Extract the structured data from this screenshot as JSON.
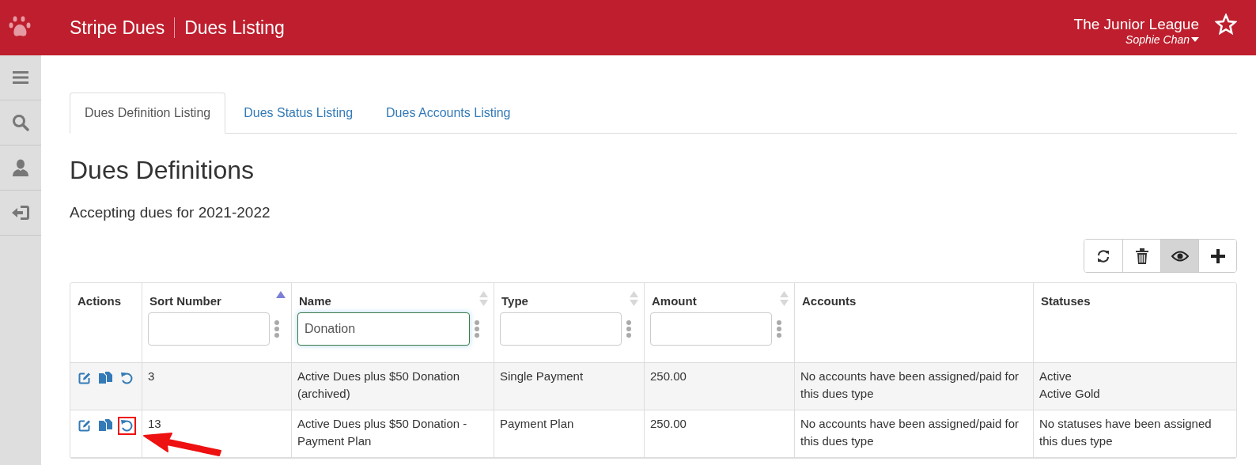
{
  "header": {
    "app_name": "Stripe Dues",
    "page_title": "Dues Listing",
    "organization": "The Junior League",
    "user": "Sophie Chan"
  },
  "sidebar": {
    "items": [
      {
        "kind": "menu"
      },
      {
        "kind": "search"
      },
      {
        "kind": "user"
      },
      {
        "kind": "logout"
      }
    ]
  },
  "tabs": [
    {
      "label": "Dues Definition Listing",
      "selected": true
    },
    {
      "label": "Dues Status Listing",
      "selected": false
    },
    {
      "label": "Dues Accounts Listing",
      "selected": false
    }
  ],
  "heading": "Dues Definitions",
  "subtitle": "Accepting dues for 2021-2022",
  "toolbar": [
    {
      "kind": "refresh",
      "pressed": false
    },
    {
      "kind": "delete",
      "pressed": false
    },
    {
      "kind": "view",
      "pressed": true
    },
    {
      "kind": "add",
      "pressed": false
    }
  ],
  "table": {
    "columns": [
      {
        "label": "Actions"
      },
      {
        "label": "Sort Number",
        "sorted": true,
        "filter": {
          "focused": false
        }
      },
      {
        "label": "Name",
        "sorted": false,
        "filter": {
          "value": "Donation",
          "focused": true
        }
      },
      {
        "label": "Type",
        "sorted": false,
        "filter": {
          "focused": false
        }
      },
      {
        "label": "Amount",
        "sorted": false,
        "filter": {
          "focused": false
        }
      },
      {
        "label": "Accounts"
      },
      {
        "label": "Statuses"
      }
    ],
    "rows": [
      {
        "actions": [
          {
            "kind": "edit",
            "highlighted": false
          },
          {
            "kind": "copy",
            "highlighted": false
          },
          {
            "kind": "restore",
            "highlighted": false
          }
        ],
        "sort_number": "3",
        "name": "Active Dues plus $50 Donation (archived)",
        "type": "Single Payment",
        "amount": "250.00",
        "accounts": "No accounts have been assigned/paid for this dues type",
        "statuses": [
          "Active",
          "Active Gold"
        ]
      },
      {
        "actions": [
          {
            "kind": "edit",
            "highlighted": false
          },
          {
            "kind": "copy",
            "highlighted": false
          },
          {
            "kind": "restore",
            "highlighted": true
          }
        ],
        "sort_number": "13",
        "name": "Active Dues plus $50 Donation - Payment Plan",
        "type": "Payment Plan",
        "amount": "250.00",
        "accounts": "No accounts have been assigned/paid for this dues type",
        "statuses": [
          "No statuses have been assigned this dues type"
        ]
      }
    ]
  }
}
